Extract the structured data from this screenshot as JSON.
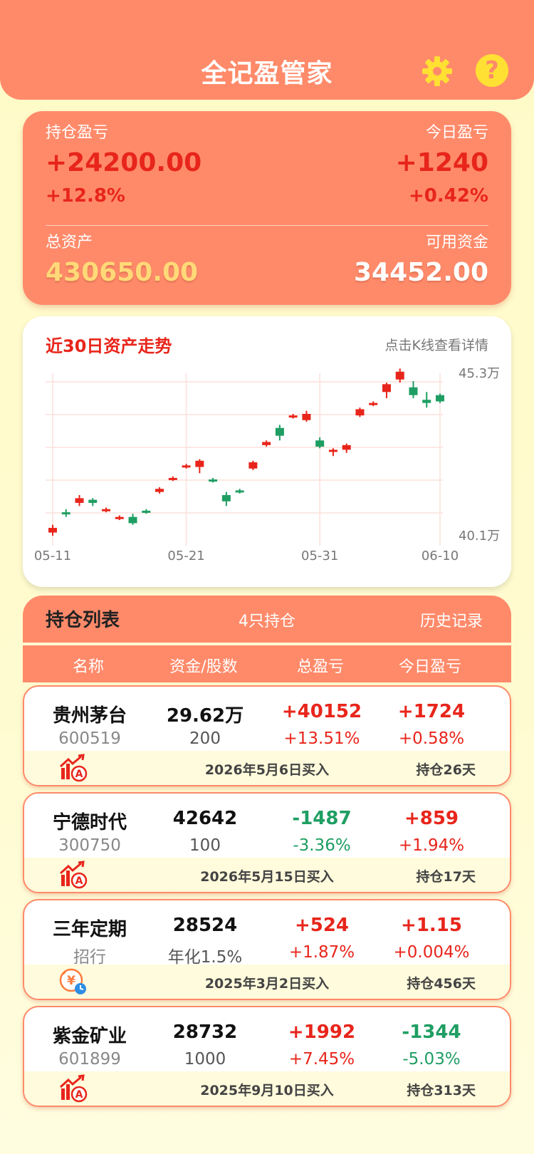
{
  "header": {
    "title": "全记盈管家",
    "help_glyph": "?"
  },
  "summary": {
    "position_pnl_label": "持仓盈亏",
    "position_pnl_value": "+24200.00",
    "position_pnl_pct": "+12.8%",
    "today_pnl_label": "今日盈亏",
    "today_pnl_value": "+1240",
    "today_pnl_pct": "+0.42%",
    "total_assets_label": "总资产",
    "total_assets_value": "430650.00",
    "available_funds_label": "可用资金",
    "available_funds_value": "34452.00"
  },
  "chart": {
    "title": "近30日资产走势",
    "hint": "点击K线查看详情"
  },
  "chart_data": {
    "type": "candlestick",
    "title": "近30日资产走势",
    "y_unit": "万",
    "ylim": [
      40.1,
      45.3
    ],
    "y_tick_labels": [
      "45.3万",
      "40.1万"
    ],
    "x_tick_labels": [
      "05-11",
      "05-21",
      "05-31",
      "06-10"
    ],
    "grid": true,
    "up_color": "#e8251b",
    "down_color": "#1f9e63",
    "candles": [
      {
        "open": 40.2,
        "close": 40.35,
        "high": 40.45,
        "low": 40.1
      },
      {
        "open": 40.85,
        "close": 40.8,
        "high": 40.95,
        "low": 40.7
      },
      {
        "open": 41.15,
        "close": 41.3,
        "high": 41.4,
        "low": 41.05
      },
      {
        "open": 41.25,
        "close": 41.15,
        "high": 41.3,
        "low": 41.05
      },
      {
        "open": 40.9,
        "close": 40.95,
        "high": 41.0,
        "low": 40.85
      },
      {
        "open": 40.65,
        "close": 40.7,
        "high": 40.75,
        "low": 40.6
      },
      {
        "open": 40.7,
        "close": 40.5,
        "high": 40.8,
        "low": 40.45
      },
      {
        "open": 40.9,
        "close": 40.85,
        "high": 40.95,
        "low": 40.8
      },
      {
        "open": 41.5,
        "close": 41.6,
        "high": 41.65,
        "low": 41.45
      },
      {
        "open": 41.9,
        "close": 41.95,
        "high": 42.0,
        "low": 41.85
      },
      {
        "open": 42.3,
        "close": 42.35,
        "high": 42.4,
        "low": 42.25
      },
      {
        "open": 42.3,
        "close": 42.5,
        "high": 42.55,
        "low": 42.1
      },
      {
        "open": 41.9,
        "close": 41.85,
        "high": 41.95,
        "low": 41.8
      },
      {
        "open": 41.4,
        "close": 41.2,
        "high": 41.5,
        "low": 41.05
      },
      {
        "open": 41.55,
        "close": 41.5,
        "high": 41.6,
        "low": 41.45
      },
      {
        "open": 42.25,
        "close": 42.45,
        "high": 42.5,
        "low": 42.2
      },
      {
        "open": 43.0,
        "close": 43.1,
        "high": 43.15,
        "low": 42.95
      },
      {
        "open": 43.55,
        "close": 43.3,
        "high": 43.65,
        "low": 43.15
      },
      {
        "open": 43.9,
        "close": 43.95,
        "high": 44.0,
        "low": 43.85
      },
      {
        "open": 43.8,
        "close": 44.0,
        "high": 44.1,
        "low": 43.75
      },
      {
        "open": 43.15,
        "close": 42.95,
        "high": 43.25,
        "low": 42.9
      },
      {
        "open": 42.8,
        "close": 42.85,
        "high": 42.9,
        "low": 42.65
      },
      {
        "open": 42.85,
        "close": 43.0,
        "high": 43.05,
        "low": 42.75
      },
      {
        "open": 43.95,
        "close": 44.15,
        "high": 44.2,
        "low": 43.9
      },
      {
        "open": 44.3,
        "close": 44.35,
        "high": 44.4,
        "low": 44.25
      },
      {
        "open": 44.7,
        "close": 44.95,
        "high": 45.0,
        "low": 44.5
      },
      {
        "open": 45.1,
        "close": 45.35,
        "high": 45.45,
        "low": 45.0
      },
      {
        "open": 44.85,
        "close": 44.6,
        "high": 45.05,
        "low": 44.5
      },
      {
        "open": 44.45,
        "close": 44.35,
        "high": 44.7,
        "low": 44.2
      },
      {
        "open": 44.6,
        "close": 44.4,
        "high": 44.65,
        "low": 44.35
      }
    ]
  },
  "holdings": {
    "title": "持仓列表",
    "count": "4只持仓",
    "history": "历史记录",
    "columns": [
      "名称",
      "资金/股数",
      "总盈亏",
      "今日盈亏"
    ],
    "items": [
      {
        "name": "贵州茅台",
        "code": "600519",
        "amount": "29.62万",
        "shares": "200",
        "total_pnl": "+40152",
        "total_pct": "+13.51%",
        "total_dir": "up",
        "today_pnl": "+1724",
        "today_pct": "+0.58%",
        "today_dir": "up",
        "bought": "2026年5月6日买入",
        "held": "持仓26天",
        "icon": "stock-trend-icon"
      },
      {
        "name": "宁德时代",
        "code": "300750",
        "amount": "42642",
        "shares": "100",
        "total_pnl": "-1487",
        "total_pct": "-3.36%",
        "total_dir": "down",
        "today_pnl": "+859",
        "today_pct": "+1.94%",
        "today_dir": "up",
        "bought": "2026年5月15日买入",
        "held": "持仓17天",
        "icon": "stock-trend-icon"
      },
      {
        "name": "三年定期",
        "code": "招行",
        "amount": "28524",
        "shares": "年化1.5%",
        "total_pnl": "+524",
        "total_pct": "+1.87%",
        "total_dir": "up",
        "today_pnl": "+1.15",
        "today_pct": "+0.004%",
        "today_dir": "up",
        "bought": "2025年3月2日买入",
        "held": "持仓456天",
        "icon": "deposit-clock-icon"
      },
      {
        "name": "紫金矿业",
        "code": "601899",
        "amount": "28732",
        "shares": "1000",
        "total_pnl": "+1992",
        "total_pct": "+7.45%",
        "total_dir": "up",
        "today_pnl": "-1344",
        "today_pct": "-5.03%",
        "today_dir": "down",
        "bought": "2025年9月10日买入",
        "held": "持仓313天",
        "icon": "stock-trend-icon"
      }
    ]
  }
}
